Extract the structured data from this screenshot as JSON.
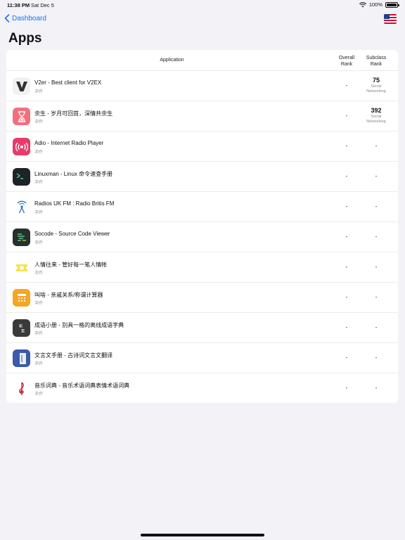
{
  "status_bar": {
    "time": "11:38 PM",
    "date": "Sat Dec 5",
    "battery": "100%"
  },
  "nav": {
    "back_label": "Dashboard",
    "flag_icon": "us-flag-icon"
  },
  "page_title": "Apps",
  "table": {
    "headers": {
      "application": "Application",
      "overall_rank": "Overall Rank",
      "subclass_rank": "Subclass Rank"
    },
    "rows": [
      {
        "name": "V2er - Best client for V2EX",
        "developer": "冲乔",
        "overall": "-",
        "subclass": "75",
        "category": "Social Networking",
        "icon": "v2er-icon"
      },
      {
        "name": "余生 - 岁月可回首，深情共余生",
        "developer": "冲乔",
        "overall": "-",
        "subclass": "392",
        "category": "Social Networking",
        "icon": "hourglass-icon"
      },
      {
        "name": "Adio - Internet Radio Player",
        "developer": "冲乔",
        "overall": "-",
        "subclass": "-",
        "category": "",
        "icon": "radio-icon"
      },
      {
        "name": "Linuxman - Linux 命令速查手册",
        "developer": "冲乔",
        "overall": "-",
        "subclass": "-",
        "category": "",
        "icon": "terminal-icon"
      },
      {
        "name": "Radios UK FM : Radio Britis FM",
        "developer": "冲乔",
        "overall": "-",
        "subclass": "-",
        "category": "",
        "icon": "antenna-icon"
      },
      {
        "name": "Socode - Source Code Viewer",
        "developer": "冲乔",
        "overall": "-",
        "subclass": "-",
        "category": "",
        "icon": "code-icon"
      },
      {
        "name": "人情往来 - 管好每一笔人情帐",
        "developer": "冲乔",
        "overall": "-",
        "subclass": "-",
        "category": "",
        "icon": "ticket-icon"
      },
      {
        "name": "叫啥 - 亲戚关系/称谓计算器",
        "developer": "冲乔",
        "overall": "-",
        "subclass": "-",
        "category": "",
        "icon": "calculator-icon"
      },
      {
        "name": "成语小册 - 别具一格的离线成语字典",
        "developer": "冲乔",
        "overall": "-",
        "subclass": "-",
        "category": "",
        "icon": "idiom-icon"
      },
      {
        "name": "文言文手册 - 古诗词文言文翻译",
        "developer": "冲乔",
        "overall": "-",
        "subclass": "-",
        "category": "",
        "icon": "book-icon"
      },
      {
        "name": "音乐词典 - 音乐术语词典表情术语词典",
        "developer": "冲乔",
        "overall": "-",
        "subclass": "-",
        "category": "",
        "icon": "music-icon"
      }
    ]
  }
}
